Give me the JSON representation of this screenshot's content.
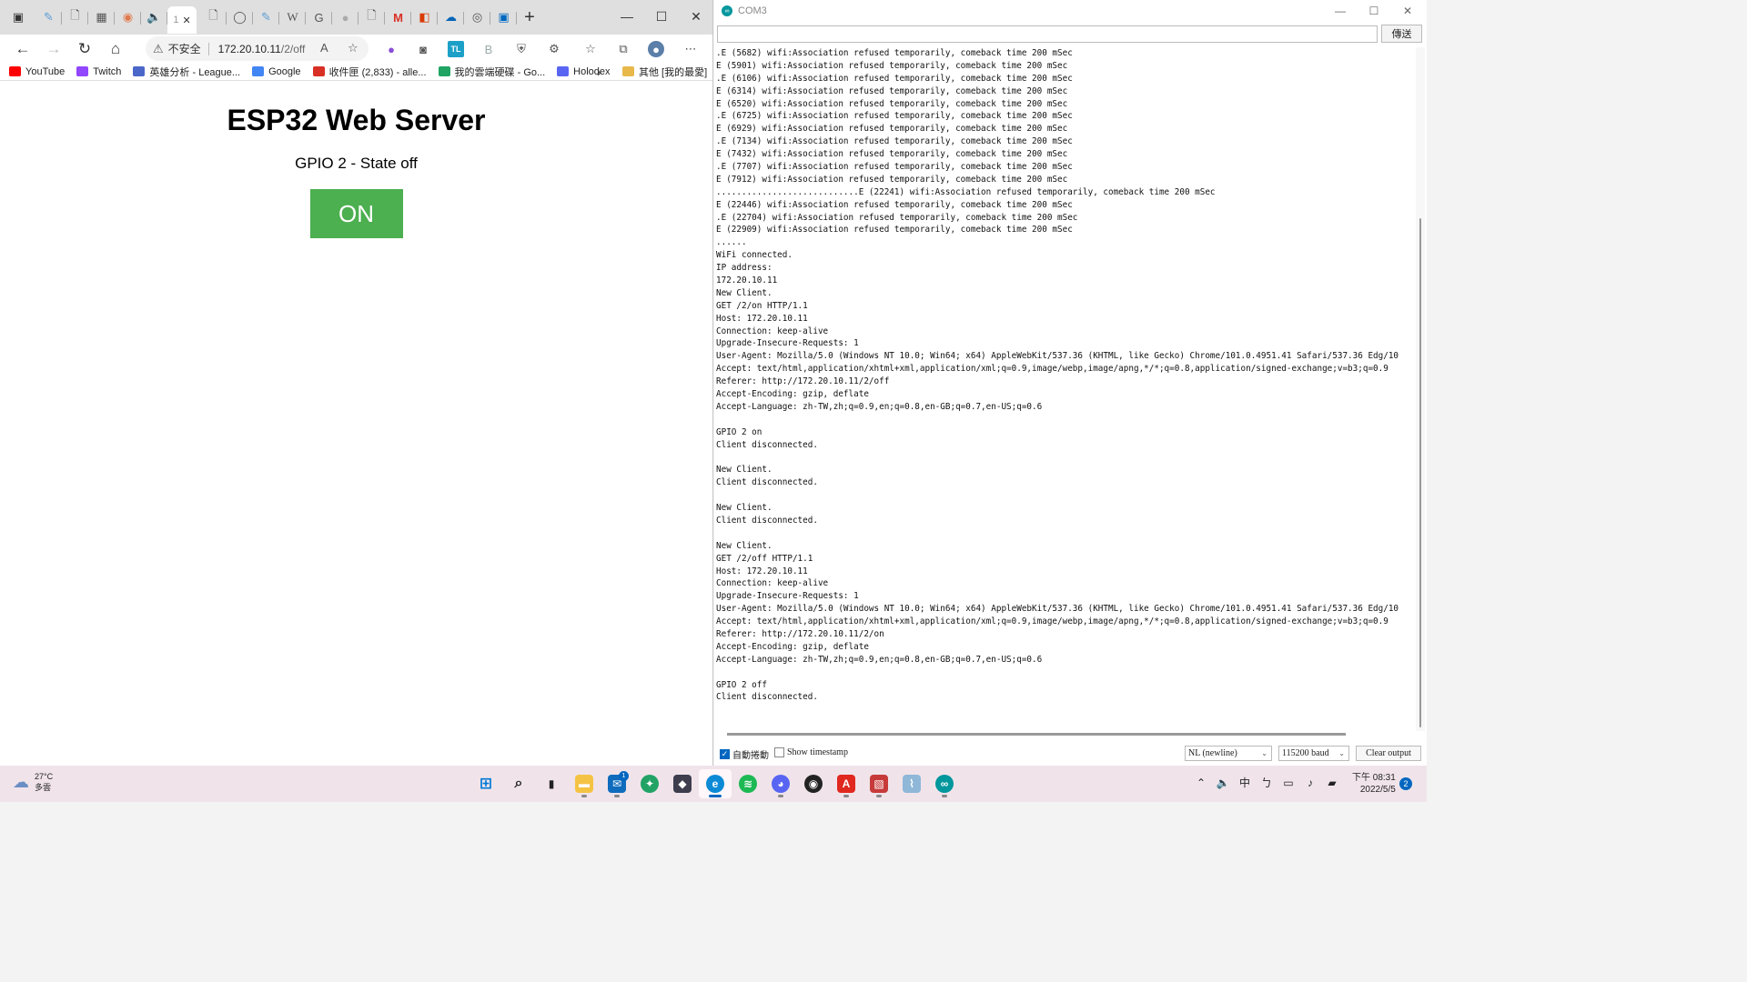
{
  "browser": {
    "tabs": {
      "active_number": "1",
      "new_tab": "+"
    },
    "address": {
      "insecure_label": "不安全",
      "host": "172.20.10.11",
      "path": "/2/off"
    },
    "bookmarks": [
      {
        "label": "YouTube",
        "icon": "youtube-icon",
        "color": "#ff0000"
      },
      {
        "label": "Twitch",
        "icon": "twitch-icon",
        "color": "#9146ff"
      },
      {
        "label": "英雄分析 - League...",
        "icon": "league-icon",
        "color": "#4a67c9"
      },
      {
        "label": "Google",
        "icon": "google-icon",
        "color": "#4285f4"
      },
      {
        "label": "收件匣 (2,833) - alle...",
        "icon": "gmail-icon",
        "color": "#d93025"
      },
      {
        "label": "我的雲端硬碟 - Go...",
        "icon": "drive-icon",
        "color": "#1fa463"
      },
      {
        "label": "Holodex",
        "icon": "holodex-icon",
        "color": "#5865f2"
      }
    ],
    "other_bookmarks": "其他 [我的最愛]",
    "page": {
      "title": "ESP32 Web Server",
      "state": "GPIO 2 - State off",
      "button_label": "ON",
      "button_color": "#4caf50"
    }
  },
  "serial": {
    "window_title": "COM3",
    "send_label": "傳送",
    "lines": [
      ".E (5682) wifi:Association refused temporarily, comeback time 200 mSec",
      "E (5901) wifi:Association refused temporarily, comeback time 200 mSec",
      ".E (6106) wifi:Association refused temporarily, comeback time 200 mSec",
      "E (6314) wifi:Association refused temporarily, comeback time 200 mSec",
      "E (6520) wifi:Association refused temporarily, comeback time 200 mSec",
      ".E (6725) wifi:Association refused temporarily, comeback time 200 mSec",
      "E (6929) wifi:Association refused temporarily, comeback time 200 mSec",
      ".E (7134) wifi:Association refused temporarily, comeback time 200 mSec",
      "E (7432) wifi:Association refused temporarily, comeback time 200 mSec",
      ".E (7707) wifi:Association refused temporarily, comeback time 200 mSec",
      "E (7912) wifi:Association refused temporarily, comeback time 200 mSec",
      "............................E (22241) wifi:Association refused temporarily, comeback time 200 mSec",
      "E (22446) wifi:Association refused temporarily, comeback time 200 mSec",
      ".E (22704) wifi:Association refused temporarily, comeback time 200 mSec",
      "E (22909) wifi:Association refused temporarily, comeback time 200 mSec",
      "......",
      "WiFi connected.",
      "IP address:",
      "172.20.10.11",
      "New Client.",
      "GET /2/on HTTP/1.1",
      "Host: 172.20.10.11",
      "Connection: keep-alive",
      "Upgrade-Insecure-Requests: 1",
      "User-Agent: Mozilla/5.0 (Windows NT 10.0; Win64; x64) AppleWebKit/537.36 (KHTML, like Gecko) Chrome/101.0.4951.41 Safari/537.36 Edg/10",
      "Accept: text/html,application/xhtml+xml,application/xml;q=0.9,image/webp,image/apng,*/*;q=0.8,application/signed-exchange;v=b3;q=0.9",
      "Referer: http://172.20.10.11/2/off",
      "Accept-Encoding: gzip, deflate",
      "Accept-Language: zh-TW,zh;q=0.9,en;q=0.8,en-GB;q=0.7,en-US;q=0.6",
      "",
      "GPIO 2 on",
      "Client disconnected.",
      "",
      "New Client.",
      "Client disconnected.",
      "",
      "New Client.",
      "Client disconnected.",
      "",
      "New Client.",
      "GET /2/off HTTP/1.1",
      "Host: 172.20.10.11",
      "Connection: keep-alive",
      "Upgrade-Insecure-Requests: 1",
      "User-Agent: Mozilla/5.0 (Windows NT 10.0; Win64; x64) AppleWebKit/537.36 (KHTML, like Gecko) Chrome/101.0.4951.41 Safari/537.36 Edg/10",
      "Accept: text/html,application/xhtml+xml,application/xml;q=0.9,image/webp,image/apng,*/*;q=0.8,application/signed-exchange;v=b3;q=0.9",
      "Referer: http://172.20.10.11/2/on",
      "Accept-Encoding: gzip, deflate",
      "Accept-Language: zh-TW,zh;q=0.9,en;q=0.8,en-GB;q=0.7,en-US;q=0.6",
      "",
      "GPIO 2 off",
      "Client disconnected."
    ],
    "autoscroll_label": "自動捲動",
    "autoscroll_checked": true,
    "timestamp_label": "Show timestamp",
    "timestamp_checked": false,
    "line_ending": "NL (newline)",
    "baud": "115200 baud",
    "clear_label": "Clear output"
  },
  "taskbar": {
    "weather_temp": "27°C",
    "weather_desc": "多雲",
    "mail_badge": "1",
    "time": "下午 08:31",
    "date": "2022/5/5",
    "notifications": "2",
    "ime": "中"
  }
}
